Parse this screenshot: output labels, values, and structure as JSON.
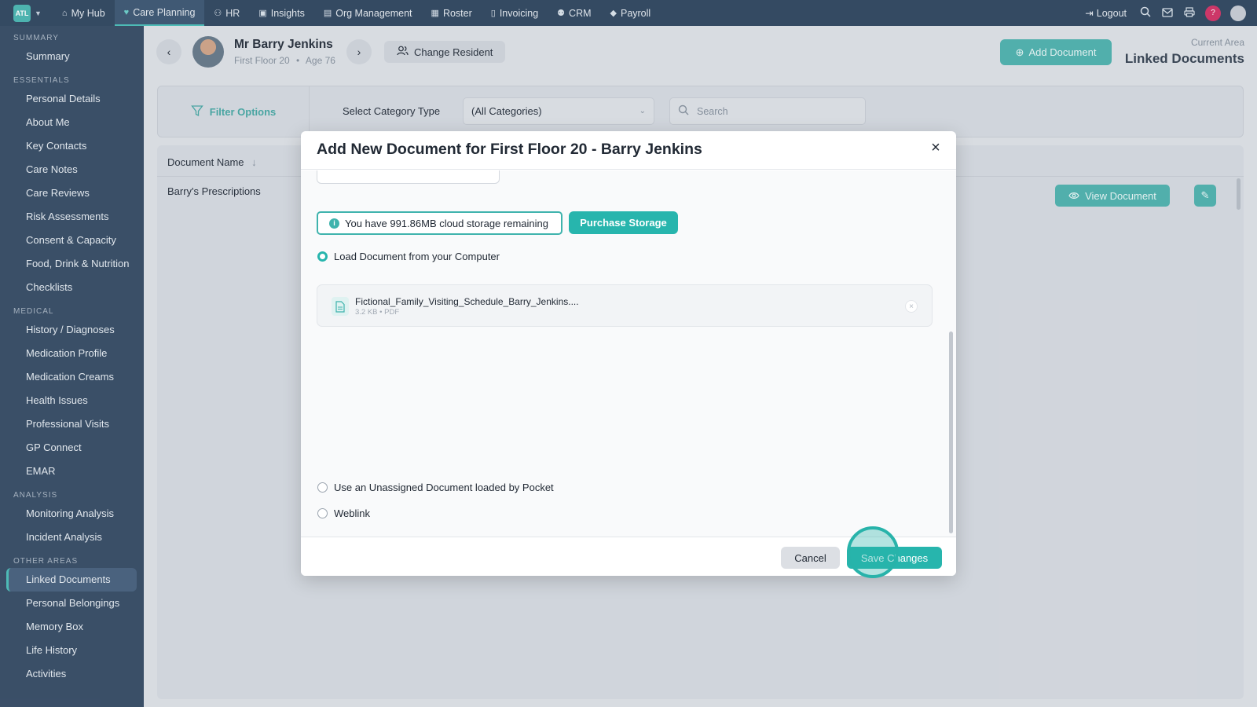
{
  "brand": {
    "logo_text": "ATL"
  },
  "topnav": {
    "items": [
      {
        "label": "My Hub",
        "icon": "home-icon",
        "glyph": "⌂"
      },
      {
        "label": "Care Planning",
        "icon": "heart-icon",
        "glyph": "♥"
      },
      {
        "label": "HR",
        "icon": "users-icon",
        "glyph": "⚇"
      },
      {
        "label": "Insights",
        "icon": "chart-icon",
        "glyph": "▣"
      },
      {
        "label": "Org Management",
        "icon": "building-icon",
        "glyph": "▤"
      },
      {
        "label": "Roster",
        "icon": "calendar-icon",
        "glyph": "▦"
      },
      {
        "label": "Invoicing",
        "icon": "file-icon",
        "glyph": "▯"
      },
      {
        "label": "CRM",
        "icon": "contacts-icon",
        "glyph": "⚉"
      },
      {
        "label": "Payroll",
        "icon": "tag-icon",
        "glyph": "◆"
      }
    ],
    "logout_label": "Logout",
    "help_label": "?"
  },
  "sidebar": {
    "sections": [
      {
        "title": "Summary",
        "items": [
          "Summary"
        ]
      },
      {
        "title": "Essentials",
        "items": [
          "Personal Details",
          "About Me",
          "Key Contacts",
          "Care Notes",
          "Care Reviews",
          "Risk Assessments",
          "Consent & Capacity",
          "Food, Drink & Nutrition",
          "Checklists"
        ]
      },
      {
        "title": "Medical",
        "items": [
          "History / Diagnoses",
          "Medication Profile",
          "Medication Creams",
          "Health Issues",
          "Professional Visits",
          "GP Connect",
          "EMAR"
        ]
      },
      {
        "title": "Analysis",
        "items": [
          "Monitoring Analysis",
          "Incident Analysis"
        ]
      },
      {
        "title": "Other Areas",
        "items": [
          "Linked Documents",
          "Personal Belongings",
          "Memory Box",
          "Life History",
          "Activities"
        ]
      }
    ],
    "active_item": "Linked Documents"
  },
  "resident": {
    "name": "Mr Barry Jenkins",
    "location": "First Floor 20",
    "age": "Age 76",
    "separator": "•",
    "change_label": "Change Resident"
  },
  "header": {
    "add_document_label": "Add Document",
    "current_area_label": "Current Area",
    "current_area_value": "Linked Documents"
  },
  "filter": {
    "label": "Filter Options",
    "category_label": "Select Category Type",
    "category_value": "(All Categories)",
    "search_placeholder": "Search"
  },
  "table": {
    "column_header": "Document Name",
    "rows": [
      {
        "name": "Barry's Prescriptions",
        "view_label": "View Document"
      }
    ]
  },
  "modal": {
    "title": "Add New Document for First Floor 20 - Barry Jenkins",
    "storage_text": "You have 991.86MB cloud storage remaining",
    "purchase_label": "Purchase Storage",
    "options": {
      "computer": "Load Document from your Computer",
      "unassigned": "Use an Unassigned Document loaded by Pocket",
      "weblink": "Weblink"
    },
    "selected_option": "computer",
    "file": {
      "name": "Fictional_Family_Visiting_Schedule_Barry_Jenkins....",
      "meta": "3.2 KB • PDF"
    },
    "cancel_label": "Cancel",
    "save_label": "Save Changes"
  },
  "colors": {
    "accent": "#27b5ad",
    "nav_bg": "#354a63",
    "sidebar_bg": "#3b5069",
    "help": "#d4376a"
  }
}
